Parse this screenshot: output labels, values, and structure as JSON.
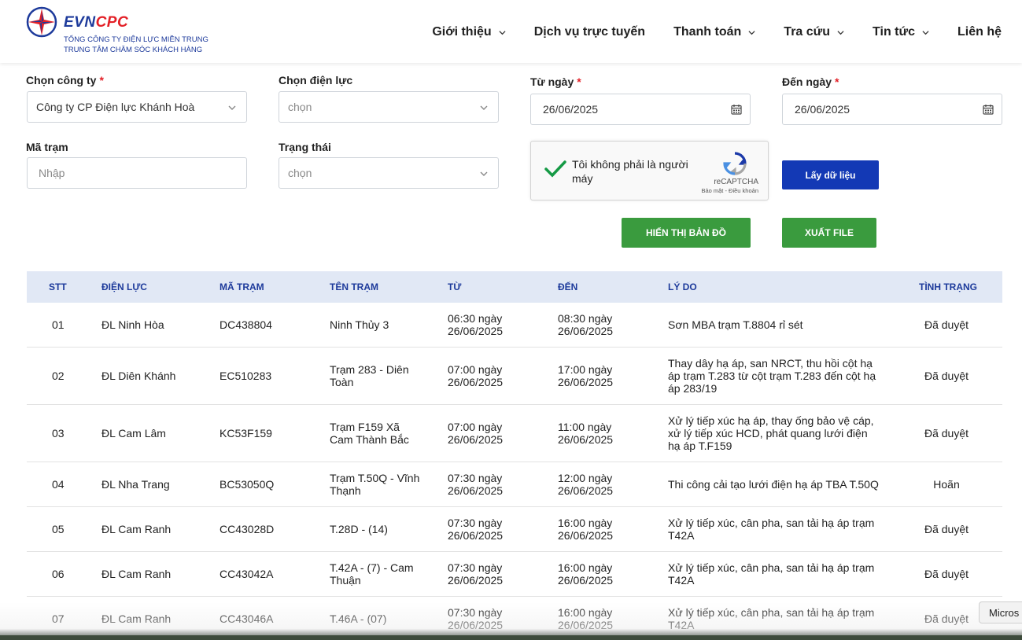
{
  "brand": {
    "name_part1": "EVN",
    "name_part2": "CPC",
    "line1": "TỔNG CÔNG TY ĐIỆN LỰC MIỀN TRUNG",
    "line2": "TRUNG TÂM CHĂM SÓC KHÁCH HÀNG",
    "colors": {
      "primary": "#1d3a9b",
      "accent": "#e32027"
    }
  },
  "nav": {
    "items": [
      {
        "label": "Giới thiệu",
        "has_dropdown": true
      },
      {
        "label": "Dịch vụ trực tuyến",
        "has_dropdown": false
      },
      {
        "label": "Thanh toán",
        "has_dropdown": true
      },
      {
        "label": "Tra cứu",
        "has_dropdown": true
      },
      {
        "label": "Tin tức",
        "has_dropdown": true
      },
      {
        "label": "Liên hệ",
        "has_dropdown": false
      }
    ]
  },
  "form": {
    "company": {
      "label": "Chọn công ty",
      "required_mark": "*",
      "value": "Công ty CP Điện lực Khánh Hoà"
    },
    "unit": {
      "label": "Chọn điện lực",
      "placeholder": "chọn"
    },
    "from_date": {
      "label": "Từ ngày",
      "required_mark": "*",
      "value": "26/06/2025"
    },
    "to_date": {
      "label": "Đến ngày",
      "required_mark": "*",
      "value": "26/06/2025"
    },
    "station_code": {
      "label": "Mã trạm",
      "placeholder": "Nhập"
    },
    "status": {
      "label": "Trạng thái",
      "placeholder": "chọn"
    },
    "captcha": {
      "text": "Tôi không phải là người máy",
      "brand": "reCAPTCHA",
      "terms": "Bảo mật - Điều khoản",
      "checked": true
    },
    "buttons": {
      "get_data": "Lấy dữ liệu",
      "show_map": "HIỂN THỊ BẢN ĐỒ",
      "export_file": "XUẤT FILE"
    },
    "button_colors": {
      "blue": "#1339b5",
      "green": "#3a9b3e"
    }
  },
  "table": {
    "headers": {
      "stt": "STT",
      "unit": "ĐIỆN LỰC",
      "code": "MÃ TRẠM",
      "name": "TÊN TRẠM",
      "from": "TỪ",
      "to": "ĐẾN",
      "reason": "LÝ DO",
      "status": "TÌNH TRẠNG"
    },
    "rows": [
      {
        "stt": "01",
        "unit": "ĐL Ninh Hòa",
        "code": "DC438804",
        "name": "Ninh Thủy 3",
        "from": "06:30 ngày 26/06/2025",
        "to": "08:30 ngày 26/06/2025",
        "reason": "Sơn MBA trạm T.8804 rỉ sét",
        "status": "Đã duyệt"
      },
      {
        "stt": "02",
        "unit": "ĐL Diên Khánh",
        "code": "EC510283",
        "name": "Trạm 283 - Diên Toàn",
        "from": "07:00 ngày 26/06/2025",
        "to": "17:00 ngày 26/06/2025",
        "reason": "Thay dây hạ áp, san NRCT, thu hồi cột hạ áp trạm T.283 từ cột trạm T.283 đến cột hạ áp 283/19",
        "status": "Đã duyệt"
      },
      {
        "stt": "03",
        "unit": "ĐL Cam Lâm",
        "code": "KC53F159",
        "name": "Trạm F159 Xã Cam Thành Bắc",
        "from": "07:00 ngày 26/06/2025",
        "to": "11:00 ngày 26/06/2025",
        "reason": "Xử lý tiếp xúc hạ áp, thay ống bảo vệ cáp, xử lý tiếp xúc HCD, phát quang lưới điện hạ áp T.F159",
        "status": "Đã duyệt"
      },
      {
        "stt": "04",
        "unit": "ĐL Nha Trang",
        "code": "BC53050Q",
        "name": "Trạm T.50Q - Vĩnh Thạnh",
        "from": "07:30 ngày 26/06/2025",
        "to": "12:00 ngày 26/06/2025",
        "reason": "Thi công cải tạo lưới điện hạ áp TBA T.50Q",
        "status": "Hoãn"
      },
      {
        "stt": "05",
        "unit": "ĐL Cam Ranh",
        "code": "CC43028D",
        "name": "T.28D - (14)",
        "from": "07:30 ngày 26/06/2025",
        "to": "16:00 ngày 26/06/2025",
        "reason": "Xử lý tiếp xúc, cân pha, san tải hạ áp trạm T42A",
        "status": "Đã duyệt"
      },
      {
        "stt": "06",
        "unit": "ĐL Cam Ranh",
        "code": "CC43042A",
        "name": "T.42A - (7) - Cam Thuận",
        "from": "07:30 ngày 26/06/2025",
        "to": "16:00 ngày 26/06/2025",
        "reason": "Xử lý tiếp xúc, cân pha, san tải hạ áp trạm T42A",
        "status": "Đã duyệt"
      },
      {
        "stt": "07",
        "unit": "ĐL Cam Ranh",
        "code": "CC43046A",
        "name": "T.46A - (07)",
        "from": "07:30 ngày 26/06/2025",
        "to": "16:00 ngày 26/06/2025",
        "reason": "Xử lý tiếp xúc, cân pha, san tải hạ áp trạm T42A",
        "status": "Đã duyệt"
      }
    ]
  },
  "overlay": {
    "badge": "Micros"
  }
}
